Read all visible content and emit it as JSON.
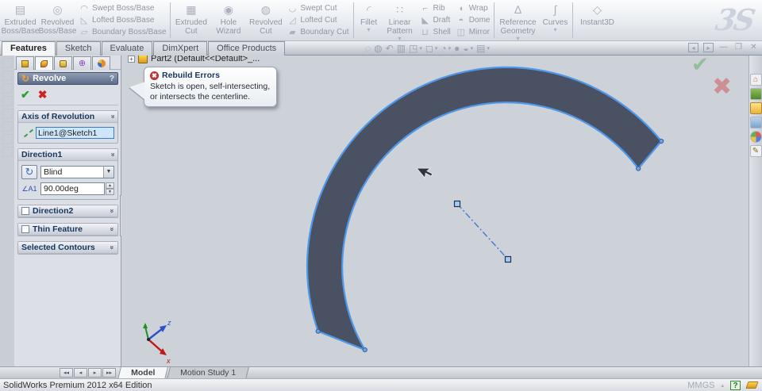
{
  "ribbon": {
    "boss_large": [
      "Extruded Boss/Base",
      "Revolved Boss/Base"
    ],
    "boss_stack": [
      "Swept Boss/Base",
      "Lofted Boss/Base",
      "Boundary Boss/Base"
    ],
    "cut_large": [
      "Extruded Cut",
      "Hole Wizard",
      "Revolved Cut"
    ],
    "cut_stack": [
      "Swept Cut",
      "Lofted Cut",
      "Boundary Cut"
    ],
    "feature_large": [
      "Fillet",
      "Linear Pattern"
    ],
    "feature_stack1": [
      "Rib",
      "Draft",
      "Shell"
    ],
    "feature_stack2": [
      "Wrap",
      "Dome",
      "Mirror"
    ],
    "reference_large": [
      "Reference Geometry",
      "Curves"
    ],
    "instant3d_label": "Instant3D"
  },
  "command_tabs": [
    "Features",
    "Sketch",
    "Evaluate",
    "DimXpert",
    "Office Products"
  ],
  "feature_tree": {
    "part_label": "Part2  (Default<<Default>_..."
  },
  "property_manager": {
    "title": "Revolve",
    "help_label": "?",
    "axis_group_title": "Axis of Revolution",
    "axis_value": "Line1@Sketch1",
    "direction1_title": "Direction1",
    "end_condition": "Blind",
    "angle_value": "90.00deg",
    "direction2_title": "Direction2",
    "thin_feature_title": "Thin Feature",
    "selected_contours_title": "Selected Contours"
  },
  "error_tooltip": {
    "title": "Rebuild Errors",
    "body": "Sketch is open, self-intersecting, or intersects the centerline."
  },
  "viewport": {
    "triad_z": "z",
    "triad_x": "x"
  },
  "bottom_bar": {
    "model_tab": "Model",
    "motion_tab": "Motion Study 1"
  },
  "status_bar": {
    "edition": "SolidWorks Premium 2012 x64 Edition",
    "units": "MMGS"
  },
  "brand": {
    "logo": "3S"
  },
  "colors": {
    "arc_fill": "#4a5162",
    "arc_outline": "#4f97e8",
    "centerline": "#3f7ad6",
    "error_red": "#a01818",
    "header_blue": "#17365d"
  }
}
